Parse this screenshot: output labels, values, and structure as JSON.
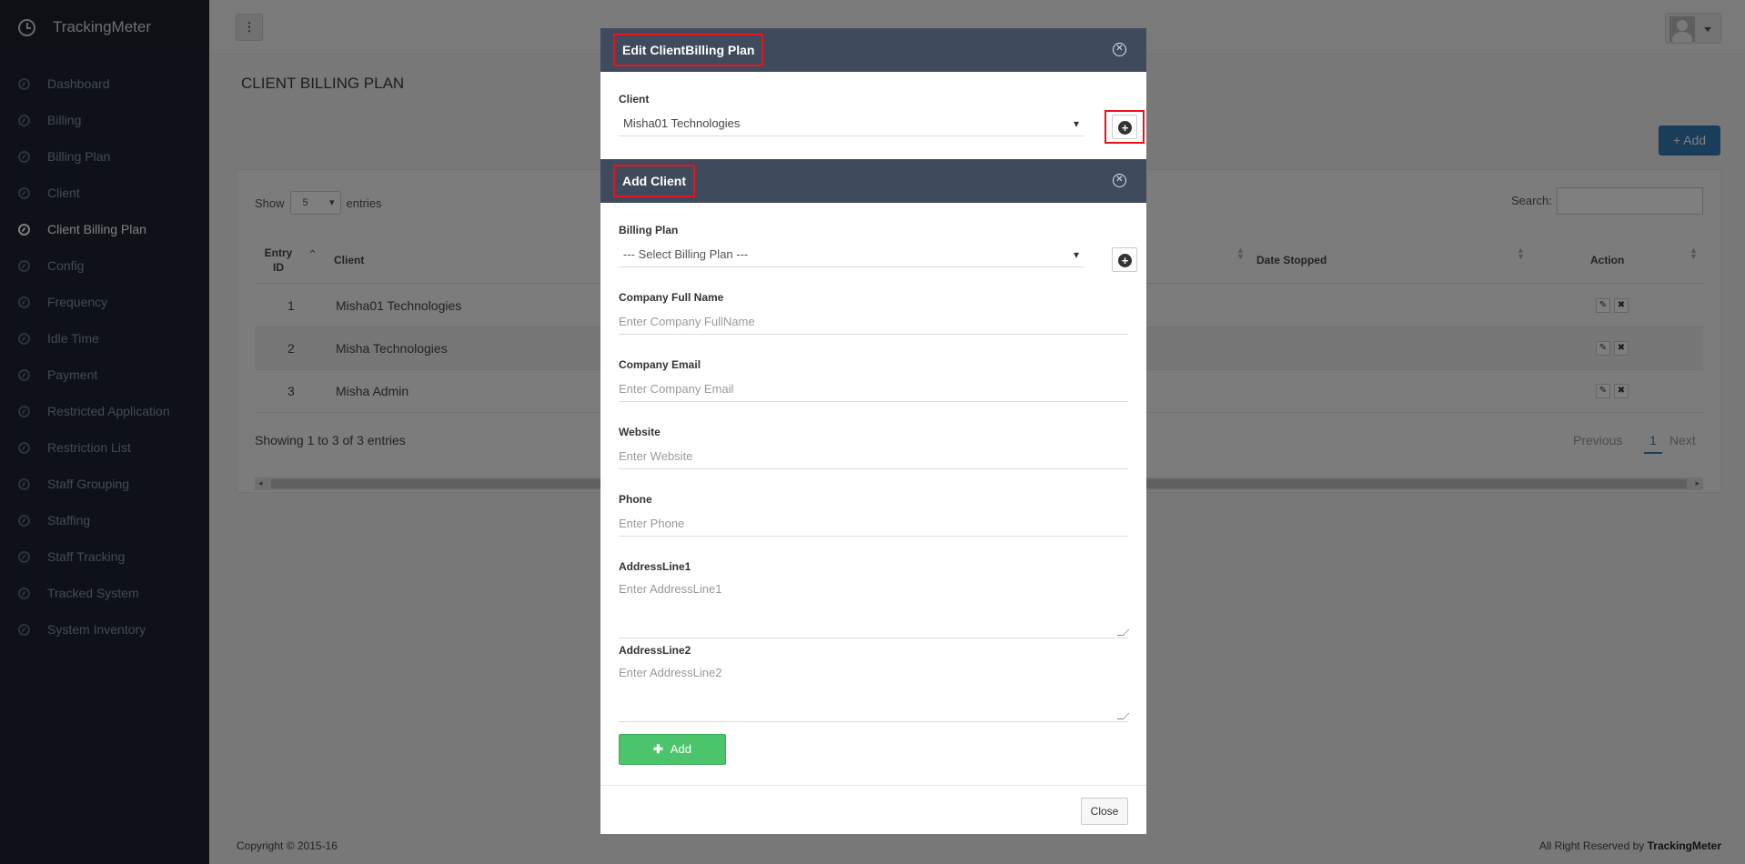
{
  "app": {
    "brand": "TrackingMeter"
  },
  "sidebar": {
    "items": [
      {
        "label": "Dashboard"
      },
      {
        "label": "Billing"
      },
      {
        "label": "Billing Plan"
      },
      {
        "label": "Client"
      },
      {
        "label": "Client Billing Plan"
      },
      {
        "label": "Config"
      },
      {
        "label": "Frequency"
      },
      {
        "label": "Idle Time"
      },
      {
        "label": "Payment"
      },
      {
        "label": "Restricted Application"
      },
      {
        "label": "Restriction List"
      },
      {
        "label": "Staff Grouping"
      },
      {
        "label": "Staffing"
      },
      {
        "label": "Staff Tracking"
      },
      {
        "label": "Tracked System"
      },
      {
        "label": "System Inventory"
      }
    ],
    "active": "Client Billing Plan"
  },
  "topbar": {
    "menu_glyph": "⋮"
  },
  "page": {
    "title": "CLIENT BILLING PLAN",
    "add_label": "+ Add",
    "show_label": "Show",
    "entries_label": "entries",
    "length_value": "5",
    "search_label": "Search:",
    "columns": {
      "entry_id": "Entry ID",
      "client": "Client",
      "date_stopped": "Date Stopped",
      "action": "Action"
    },
    "rows": [
      {
        "id": "1",
        "client": "Misha01 Technologies"
      },
      {
        "id": "2",
        "client": "Misha Technologies"
      },
      {
        "id": "3",
        "client": "Misha Admin"
      }
    ],
    "showing": "Showing 1 to 3 of 3 entries",
    "pager": {
      "previous": "Previous",
      "current": "1",
      "next": "Next"
    }
  },
  "footer": {
    "copyright": "Copyright © 2015-16",
    "rights_prefix": "All Right Reserved by",
    "rights_brand": "TrackingMeter"
  },
  "edit_modal": {
    "title": "Edit ClientBilling Plan",
    "client_label": "Client",
    "client_value": "Misha01 Technologies",
    "close_label": "Close"
  },
  "add_client": {
    "title": "Add Client",
    "billing_plan_label": "Billing Plan",
    "billing_plan_value": "--- Select Billing Plan ---",
    "fields": {
      "company_full_name": {
        "label": "Company Full Name",
        "placeholder": "Enter Company FullName"
      },
      "company_email": {
        "label": "Company Email",
        "placeholder": "Enter Company Email"
      },
      "website": {
        "label": "Website",
        "placeholder": "Enter Website"
      },
      "phone": {
        "label": "Phone",
        "placeholder": "Enter Phone"
      },
      "address1": {
        "label": "AddressLine1",
        "placeholder": "Enter AddressLine1"
      },
      "address2": {
        "label": "AddressLine2",
        "placeholder": "Enter AddressLine2"
      }
    },
    "add_label": "Add"
  },
  "colors": {
    "sidebar_bg": "#1c2430",
    "modal_header": "#3f4a5c",
    "highlight": "#e8141b",
    "primary": "#337ab7",
    "success": "#4cc46c"
  }
}
